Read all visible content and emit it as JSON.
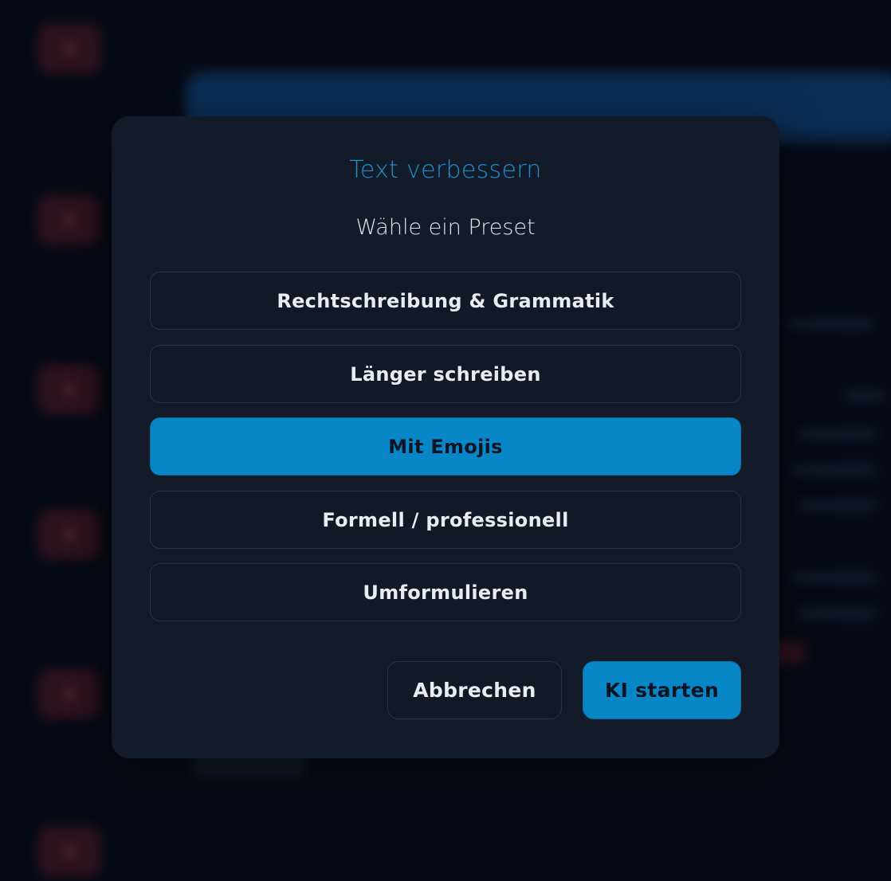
{
  "dialog": {
    "title": "Text verbessern",
    "subtitle": "Wähle ein Preset",
    "presets": [
      {
        "label": "Rechtschreibung & Grammatik",
        "selected": false
      },
      {
        "label": "Länger schreiben",
        "selected": false
      },
      {
        "label": "Mit Emojis",
        "selected": true
      },
      {
        "label": "Formell / professionell",
        "selected": false
      },
      {
        "label": "Umformulieren",
        "selected": false
      }
    ],
    "cancel_label": "Abbrechen",
    "start_label": "KI starten"
  },
  "colors": {
    "accent": "#0887c8",
    "title": "#1b8fd2",
    "modal_bg": "#141b28",
    "page_bg": "#070b16"
  }
}
